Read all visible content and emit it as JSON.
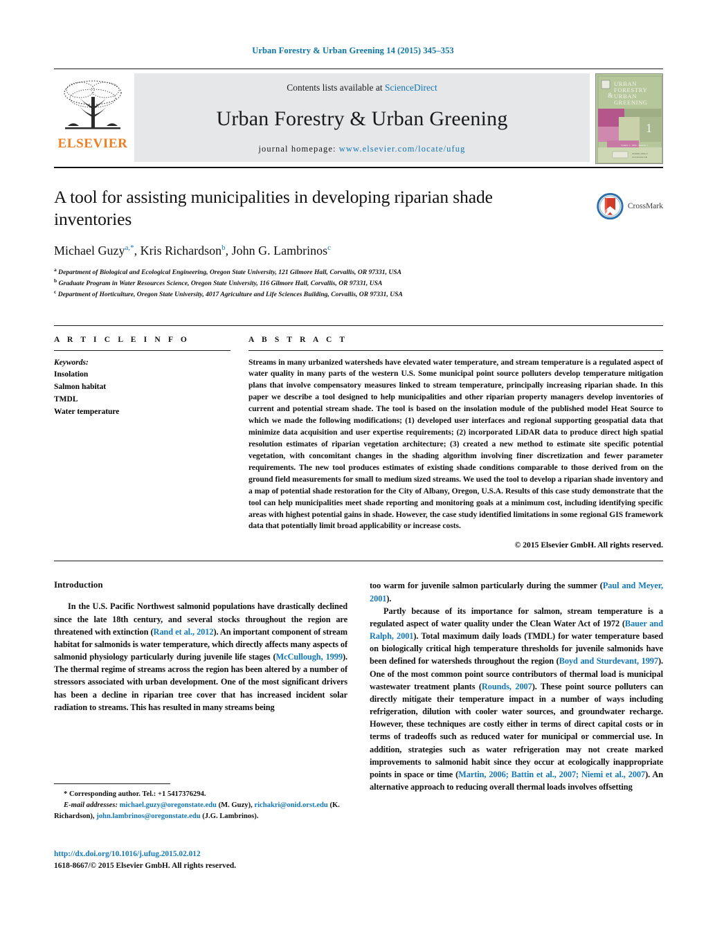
{
  "running_head": "Urban Forestry & Urban Greening 14 (2015) 345–353",
  "masthead": {
    "contents_prefix": "Contents lists available at ",
    "sciencedirect": "ScienceDirect",
    "journal_title": "Urban Forestry & Urban Greening",
    "homepage_label": "journal homepage: ",
    "homepage_url": "www.elsevier.com/locate/ufug",
    "publisher": "ELSEVIER",
    "cover": {
      "line1": "URBAN",
      "line2": "FORESTRY",
      "amp": "&",
      "line3": "URBAN",
      "line4": "GREENING",
      "issue_number": "1",
      "volume_caption": "Volume 1 - 2002 - Number 1"
    },
    "colors": {
      "link": "#1477b8",
      "elsevier_orange": "#ef7d22",
      "masthead_bg": "#e6e7e8"
    }
  },
  "article": {
    "title": "A tool for assisting municipalities in developing riparian shade inventories",
    "authors_html": "Michael Guzy|a,*|, Kris Richardson|b|, John G. Lambrinos|c|",
    "authors": [
      {
        "name": "Michael Guzy",
        "marks": "a,*"
      },
      {
        "name": "Kris Richardson",
        "marks": "b"
      },
      {
        "name": "John G. Lambrinos",
        "marks": "c"
      }
    ],
    "affiliations": [
      {
        "mark": "a",
        "text": "Department of Biological and Ecological Engineering, Oregon State University, 121 Gilmore Hall, Corvallis, OR 97331, USA"
      },
      {
        "mark": "b",
        "text": "Graduate Program in Water Resources Science, Oregon State University, 116 Gilmore Hall, Corvallis, OR 97331, USA"
      },
      {
        "mark": "c",
        "text": "Department of Horticulture, Oregon State University, 4017 Agriculture and Life Sciences Building, Corvallis, OR 97331, USA"
      }
    ],
    "crossmark_label": "CrossMark"
  },
  "article_info": {
    "heading": "A R T I C L E   I N F O",
    "keywords_label": "Keywords:",
    "keywords": [
      "Insolation",
      "Salmon habitat",
      "TMDL",
      "Water temperature"
    ]
  },
  "abstract": {
    "heading": "A B S T R A C T",
    "text": "Streams in many urbanized watersheds have elevated water temperature, and stream temperature is a regulated aspect of water quality in many parts of the western U.S. Some municipal point source polluters develop temperature mitigation plans that involve compensatory measures linked to stream temperature, principally increasing riparian shade. In this paper we describe a tool designed to help municipalities and other riparian property managers develop inventories of current and potential stream shade. The tool is based on the insolation module of the published model Heat Source to which we made the following modifications; (1) developed user interfaces and regional supporting geospatial data that minimize data acquisition and user expertise requirements; (2) incorporated LiDAR data to produce direct high spatial resolution estimates of riparian vegetation architecture; (3) created a new method to estimate site specific potential vegetation, with concomitant changes in the shading algorithm involving finer discretization and fewer parameter requirements. The new tool produces estimates of existing shade conditions comparable to those derived from on the ground field measurements for small to medium sized streams. We used the tool to develop a riparian shade inventory and a map of potential shade restoration for the City of Albany, Oregon, U.S.A. Results of this case study demonstrate that the tool can help municipalities meet shade reporting and monitoring goals at a minimum cost, including identifying specific areas with highest potential gains in shade. However, the case study identified limitations in some regional GIS framework data that potentially limit broad applicability or increase costs.",
    "copyright": "© 2015 Elsevier GmbH. All rights reserved."
  },
  "introduction": {
    "heading": "Introduction",
    "left_paragraph_1": "In the U.S. Pacific Northwest salmonid populations have drastically declined since the late 18th century, and several stocks throughout the region are threatened with extinction (|Rand et al., 2012|). An important component of stream habitat for salmonids is water temperature, which directly affects many aspects of salmonid physiology particularly during juvenile life stages (|McCullough, 1999|). The thermal regime of streams across the region has been altered by a number of stressors associated with urban development. One of the most significant drivers has been a decline in riparian tree cover that has increased incident solar radiation to streams. This has resulted in many streams being too warm for juvenile salmon particularly during the summer (|Paul and Meyer, 2001|).",
    "right_paragraph_1": "Partly because of its importance for salmon, stream temperature is a regulated aspect of water quality under the Clean Water Act of 1972 (|Bauer and Ralph, 2001|). Total maximum daily loads (TMDL) for water temperature based on biologically critical high temperature thresholds for juvenile salmonids have been defined for watersheds throughout the region (|Boyd and Sturdevant, 1997|). One of the most common point source contributors of thermal load is municipal wastewater treatment plants (|Rounds, 2007|). These point source polluters can directly mitigate their temperature impact in a number of ways including refrigeration, dilution with cooler water sources, and groundwater recharge. However, these techniques are costly either in terms of direct capital costs or in terms of tradeoffs such as reduced water for municipal or commercial use. In addition, strategies such as water refrigeration may not create marked improvements to salmonid habit since they occur at ecologically inappropriate points in space or time (|Martin, 2006; Battin et al., 2007; Niemi et al., 2007|). An alternative approach to reducing overall thermal loads involves offsetting"
  },
  "footnotes": {
    "corresponding": "* Corresponding author. Tel.: +1 5417376294.",
    "email_label": "E-mail addresses:",
    "emails": [
      {
        "address": "michael.guzy@oregonstate.edu",
        "person": "(M. Guzy)"
      },
      {
        "address": "richakri@onid.orst.edu",
        "person": "(K. Richardson)"
      },
      {
        "address": "john.lambrinos@oregonstate.edu",
        "person": "(J.G. Lambrinos)"
      }
    ]
  },
  "doi": {
    "url": "http://dx.doi.org/10.1016/j.ufug.2015.02.012",
    "issn_line": "1618-8667/© 2015 Elsevier GmbH. All rights reserved."
  }
}
